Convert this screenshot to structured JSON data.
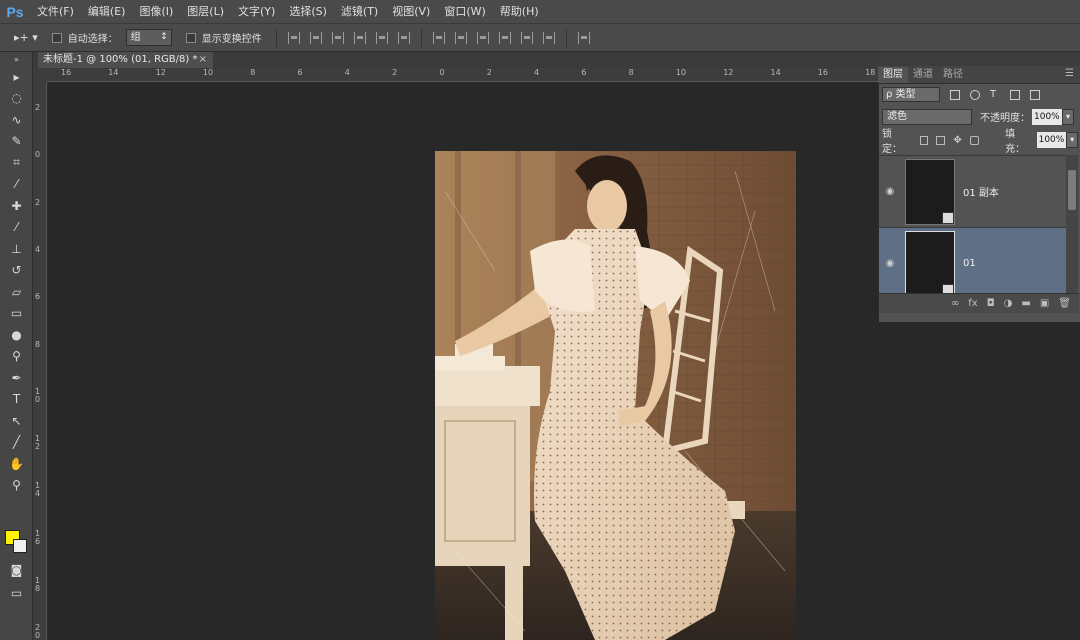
{
  "app": {
    "logo": "Ps"
  },
  "menu": [
    "文件(F)",
    "编辑(E)",
    "图像(I)",
    "图层(L)",
    "文字(Y)",
    "选择(S)",
    "滤镜(T)",
    "视图(V)",
    "窗口(W)",
    "帮助(H)"
  ],
  "options": {
    "auto_select_label": "自动选择：",
    "auto_select_value": "组",
    "show_transform_label": "显示变换控件"
  },
  "document": {
    "tab_title": "未标题-1 @ 100% (01, RGB/8) *",
    "close": "×"
  },
  "rulers": {
    "horizontal": [
      "16",
      "14",
      "12",
      "10",
      "8",
      "6",
      "4",
      "2",
      "0",
      "2",
      "4",
      "6",
      "8",
      "10",
      "12",
      "14",
      "16",
      "18"
    ],
    "vertical": [
      "2",
      "0",
      "2",
      "4",
      "6",
      "8",
      "10",
      "12",
      "14",
      "16",
      "18",
      "20"
    ]
  },
  "layers_panel": {
    "tabs": [
      "图层",
      "通道",
      "路径"
    ],
    "filter_value": "ρ 类型",
    "blend_mode": "滤色",
    "opacity_label": "不透明度：",
    "opacity_value": "100%",
    "lock_label": "锁定：",
    "fill_label": "填充：",
    "fill_value": "100%",
    "layers": [
      {
        "name": "01 副本",
        "visible": true,
        "selected": false
      },
      {
        "name": "01",
        "visible": true,
        "selected": true
      }
    ],
    "footer_icons": [
      "link-icon",
      "fx-icon",
      "mask-icon",
      "adjustment-icon",
      "folder-icon",
      "new-layer-icon",
      "trash-icon"
    ]
  },
  "colors": {
    "foreground": "#fff200",
    "background": "#f0f0f0",
    "selected_layer": "#5f6f85"
  }
}
